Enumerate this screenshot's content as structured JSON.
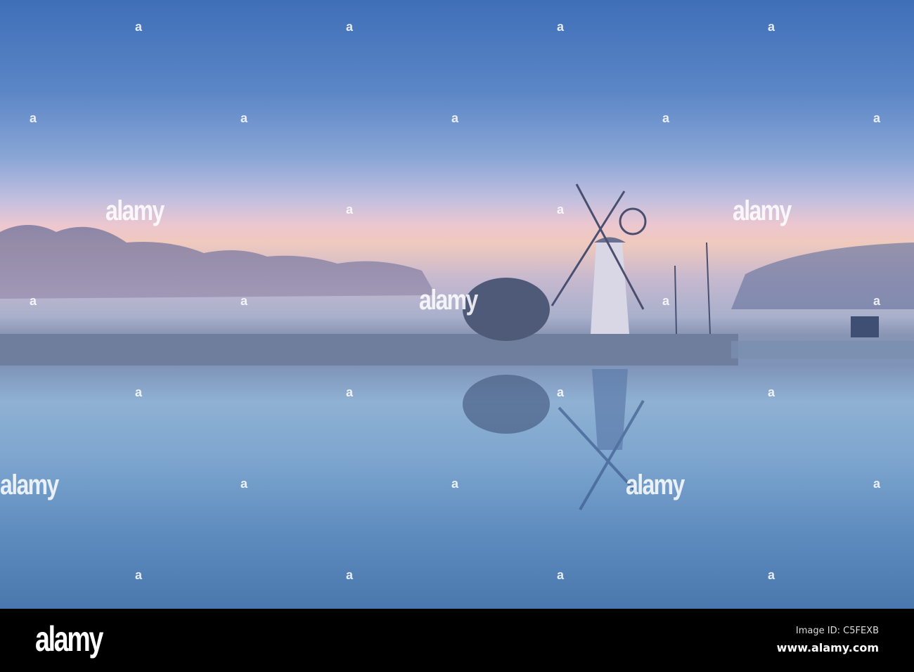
{
  "watermark": {
    "text": "alamy",
    "mark": "a"
  },
  "footer": {
    "logo": "alamy",
    "image_id": "Image ID: C5FEXB",
    "site": "www.alamy.com"
  }
}
